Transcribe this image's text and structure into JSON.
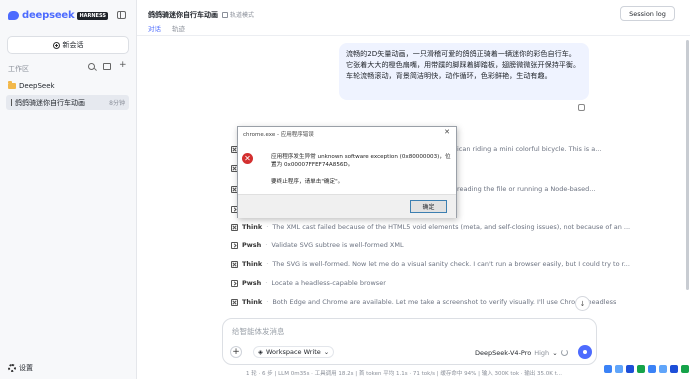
{
  "sidebar": {
    "logo_text": "deepseek",
    "logo_badge": "HARNESS",
    "new_chat": "新会话",
    "workspace_label": "工作区",
    "folder": "DeepSeek",
    "session": {
      "title": "鸽鸽骑迷你自行车动画",
      "time": "8分钟"
    },
    "settings": "设置"
  },
  "header": {
    "title": "鸽鸽骑迷你自行车动画",
    "mode": "轨道模式",
    "session_log": "Session log",
    "tabs": [
      "对话",
      "轨迹"
    ]
  },
  "message": "流畅的2D矢量动画，一只滑稽可爱的鸽鸽正骑着一辆迷你的彩色自行车。它张着大大的橙色扇嘴，用带蹼的脚踩着脚踏板，翅膀微微张开保持平衡。车轮流畅滚动，背景简洁明快，动作循环，色彩鲜艳，生动有趣。",
  "partials": {
    "p1": "ican riding a mini colorful bicycle. This is a...",
    "p2": "reading the file or running a Node-based..."
  },
  "logs": [
    {
      "kind": "Think",
      "text": "The XML cast failed because of the HTML5 void elements (meta, and self-closing issues), not because of an ..."
    },
    {
      "kind": "Pwsh",
      "text": "Validate SVG subtree is well-formed XML"
    },
    {
      "kind": "Think",
      "text": "The SVG is well-formed. Now let me do a visual sanity check. I can't run a browser easily, but I could try to r..."
    },
    {
      "kind": "Pwsh",
      "text": "Locate a headless-capable browser"
    },
    {
      "kind": "Think",
      "text": "Both Edge and Chrome are available. Let me take a screenshot to verify visually. I'll use Chrome headless"
    }
  ],
  "dialog": {
    "title": "chrome.exe - 应用程序错误",
    "close": "✕",
    "line1": "应用程序发生异常 unknown software exception (0x80000003)，位置为 0x00007FFEF74A856D。",
    "line2": "要终止程序，请单击\"确定\"。",
    "ok": "确定"
  },
  "composer": {
    "placeholder": "给智能体发消息",
    "add": "+",
    "workspace_mode": "Workspace Write",
    "model": "DeepSeek-V4-Pro",
    "effort": "High"
  },
  "status_bar": "1 轮 · 6 步 | LLM 0m35s · 工具调用 18.2s | 首 token 平均 1.1s · 71 tok/s | 缓存命中 94% | 输入 300K tok · 输出 35.0K t...",
  "scroll_down": "↓"
}
